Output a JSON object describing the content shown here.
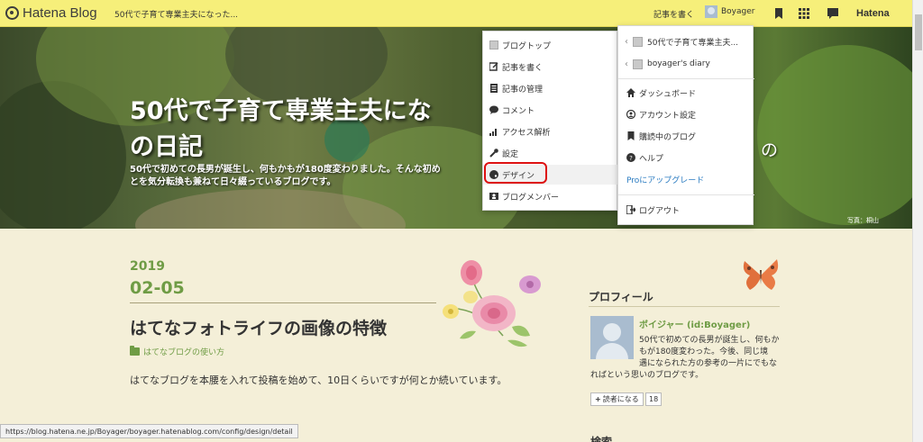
{
  "topbar": {
    "logo": "Hatena Blog",
    "blog_title": "50代で子育て専業主夫になった...",
    "write_label": "記事を書く",
    "username": "Boyager",
    "hatena": "Hatena"
  },
  "hero": {
    "title": "50代で子育て専業主夫にな\nの日記",
    "title_tail": "の",
    "description": "50代で初めての長男が誕生し、何もかもが180度変わりました。そんな初め\nとを気分転換も兼ねて日々綴っているブログです。",
    "credit": "写真：桐山"
  },
  "blog_menu": {
    "items": [
      {
        "icon": "blog-icon",
        "label": "ブログトップ"
      },
      {
        "icon": "edit-icon",
        "label": "記事を書く"
      },
      {
        "icon": "document-icon",
        "label": "記事の管理"
      },
      {
        "icon": "comment-icon",
        "label": "コメント"
      },
      {
        "icon": "chart-icon",
        "label": "アクセス解析"
      },
      {
        "icon": "wrench-icon",
        "label": "設定"
      },
      {
        "icon": "palette-icon",
        "label": "デザイン"
      },
      {
        "icon": "members-icon",
        "label": "ブログメンバー"
      }
    ],
    "highlighted": "デザイン"
  },
  "account_menu": {
    "blogs": [
      {
        "label": "50代で子育て専業主夫..."
      },
      {
        "label": "boyager's diary"
      }
    ],
    "items": [
      {
        "icon": "home-icon",
        "label": "ダッシュボード"
      },
      {
        "icon": "user-icon",
        "label": "アカウント設定"
      },
      {
        "icon": "bookmark-icon",
        "label": "購読中のブログ"
      },
      {
        "icon": "help-icon",
        "label": "ヘルプ"
      }
    ],
    "pro": "Proにアップグレード",
    "logout": "ログアウト"
  },
  "post": {
    "year": "2019",
    "month_day": "02-05",
    "title": "はてなフォトライフの画像の特徴",
    "category": "はてなブログの使い方",
    "body": "はてなブログを本腰を入れて投稿を始めて、10日くらいですが何とか続いています。"
  },
  "sidebar": {
    "profile_heading": "プロフィール",
    "name": "ボイジャー (id:Boyager)",
    "desc1": "50代で初めての長男が誕生し、何もかもが180度変わった。今後、同じ境",
    "desc2": "遇になられた方の参考の一片にでもなればという思いのブログです。",
    "subscribe": "読者になる",
    "subscriber_count": "18",
    "search_heading": "検索"
  },
  "status_url": "https://blog.hatena.ne.jp/Boyager/boyager.hatenablog.com/config/design/detail",
  "colors": {
    "topbar": "#f6ef7a",
    "accent_green": "#6f9c45",
    "highlight_ring": "#dd1111",
    "pro_link": "#2a7bc1",
    "page_bg": "#f4efd8"
  }
}
